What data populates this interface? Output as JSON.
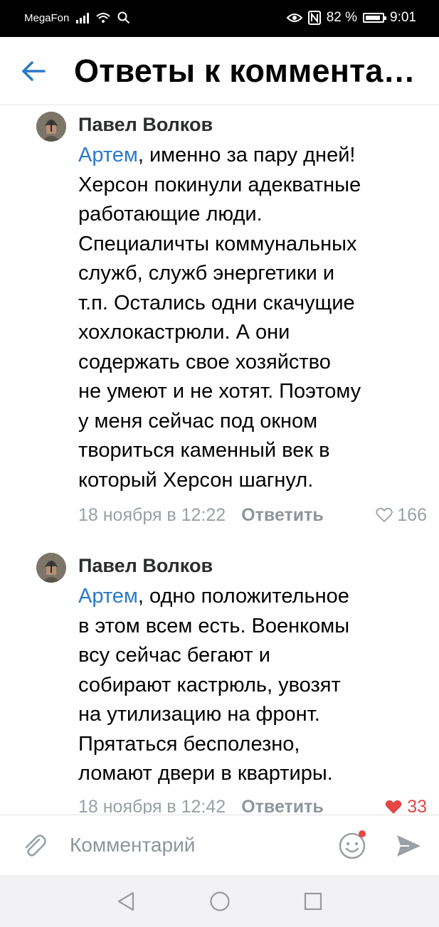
{
  "status_bar": {
    "carrier": "MegaFon",
    "battery": "82 %",
    "time": "9:01",
    "icons": [
      "signal-icon",
      "wifi-icon",
      "search-icon",
      "eye-icon",
      "nfc-icon",
      "battery-icon"
    ]
  },
  "header": {
    "title": "Ответы к комментариям",
    "back_icon": "arrow-left-icon"
  },
  "comments": [
    {
      "author": "Павел Волков",
      "mention": "Артем",
      "lines": [
        ", именно за пару дней!",
        "Херсон покинули адекватные",
        "работающие люди.",
        "Специаличты коммунальных",
        "служб, служб энергетики и",
        "т.п. Остались одни скачущие",
        "хохлокастрюли. А они",
        "содержать свое хозяйство",
        "не умеют и не хотят. Поэтому",
        "у меня сейчас под окном",
        "твориться каменный век в",
        "который Херсон шагнул."
      ],
      "date": "18 ноября в 12:22",
      "reply_label": "Ответить",
      "likes": "166",
      "liked": false
    },
    {
      "author": "Павел Волков",
      "mention": "Артем",
      "lines": [
        ", одно положительное",
        "в этом всем есть. Военкомы",
        "всу сейчас бегают и",
        "собирают кастрюль, увозят",
        "на утилизацию на фронт.",
        "Прятаться бесполезно,",
        "ломают двери в квартиры."
      ],
      "date": "18 ноября в 12:42",
      "reply_label": "Ответить",
      "likes": "33",
      "liked": true
    }
  ],
  "comment_input": {
    "placeholder": "Комментарий",
    "attach_icon": "paperclip-icon",
    "emoji_icon": "smile-icon",
    "send_icon": "send-icon"
  },
  "nav_bar": {
    "icons": [
      "back-triangle-icon",
      "home-circle-icon",
      "recents-square-icon"
    ]
  },
  "colors": {
    "accent": "#2a79c9",
    "like": "#e64646",
    "meta": "#9aa0a6"
  }
}
